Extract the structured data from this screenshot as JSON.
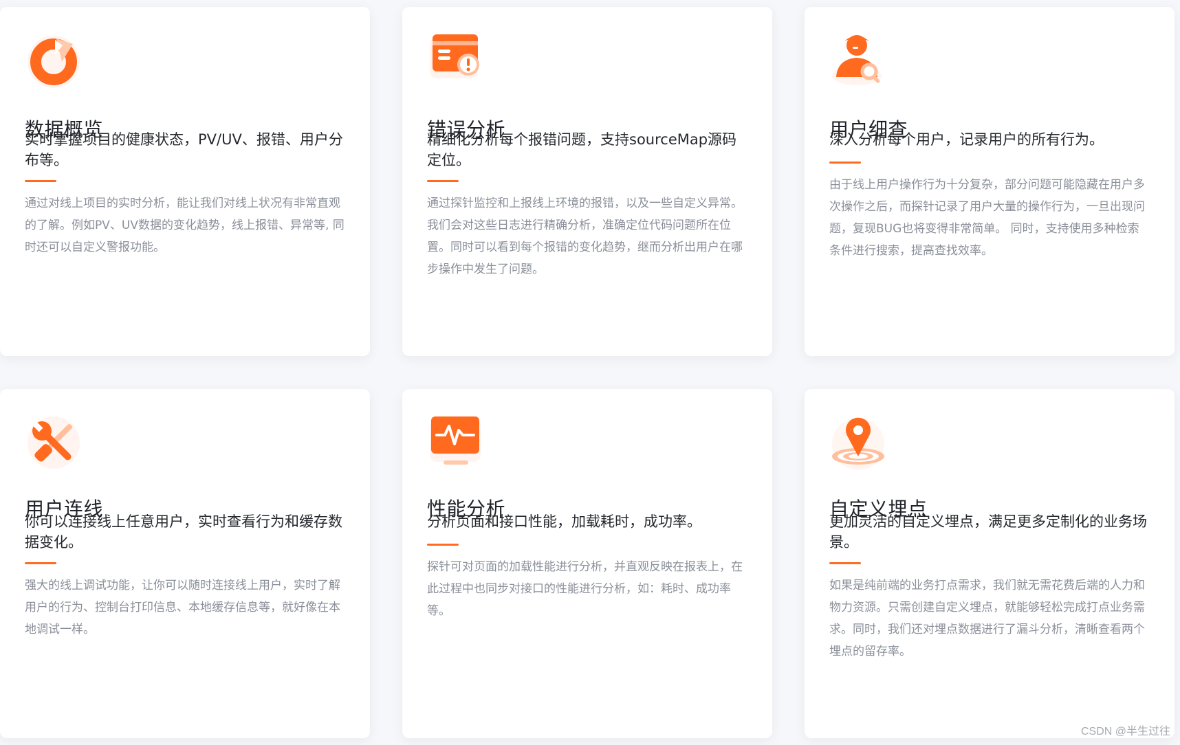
{
  "brand_color": "#ff6a1f",
  "cards": [
    {
      "icon": "pie-chart-icon",
      "title": "数据概览",
      "subtitle": "实时掌握项目的健康状态，PV/UV、报错、用户分布等。",
      "description": "通过对线上项目的实时分析，能让我们对线上状况有非常直观的了解。例如PV、UV数据的变化趋势，线上报错、异常等, 同时还可以自定义警报功能。"
    },
    {
      "icon": "error-card-icon",
      "title": "错误分析",
      "subtitle": "精细化分析每个报错问题，支持sourceMap源码定位。",
      "description": "通过探针监控和上报线上环境的报错，以及一些自定义异常。我们会对这些日志进行精确分析，准确定位代码问题所在位置。同时可以看到每个报错的变化趋势，继而分析出用户在哪步操作中发生了问题。"
    },
    {
      "icon": "user-search-icon",
      "title": "用户细查",
      "subtitle": "深入分析每个用户，记录用户的所有行为。",
      "description": "由于线上用户操作行为十分复杂，部分问题可能隐藏在用户多次操作之后，而探针记录了用户大量的操作行为，一旦出现问题，复现BUG也将变得非常简单。 同时，支持使用多种检索条件进行搜索，提高查找效率。"
    },
    {
      "icon": "wrench-tools-icon",
      "title": "用户连线",
      "subtitle": "你可以连接线上任意用户，实时查看行为和缓存数据变化。",
      "description": "强大的线上调试功能，让你可以随时连接线上用户，实时了解用户的行为、控制台打印信息、本地缓存信息等，就好像在本地调试一样。"
    },
    {
      "icon": "performance-monitor-icon",
      "title": "性能分析",
      "subtitle": "分析页面和接口性能，加载耗时，成功率。",
      "description": "探针可对页面的加载性能进行分析，并直观反映在报表上，在此过程中也同步对接口的性能进行分析，如：耗时、成功率等。"
    },
    {
      "icon": "location-pin-icon",
      "title": "自定义埋点",
      "subtitle": "更加灵活的自定义埋点，满足更多定制化的业务场景。",
      "description": "如果是纯前端的业务打点需求，我们就无需花费后端的人力和物力资源。只需创建自定义埋点，就能够轻松完成打点业务需求。同时，我们还对埋点数据进行了漏斗分析，清晰查看两个埋点的留存率。"
    }
  ],
  "watermark": "CSDN @半生过往"
}
